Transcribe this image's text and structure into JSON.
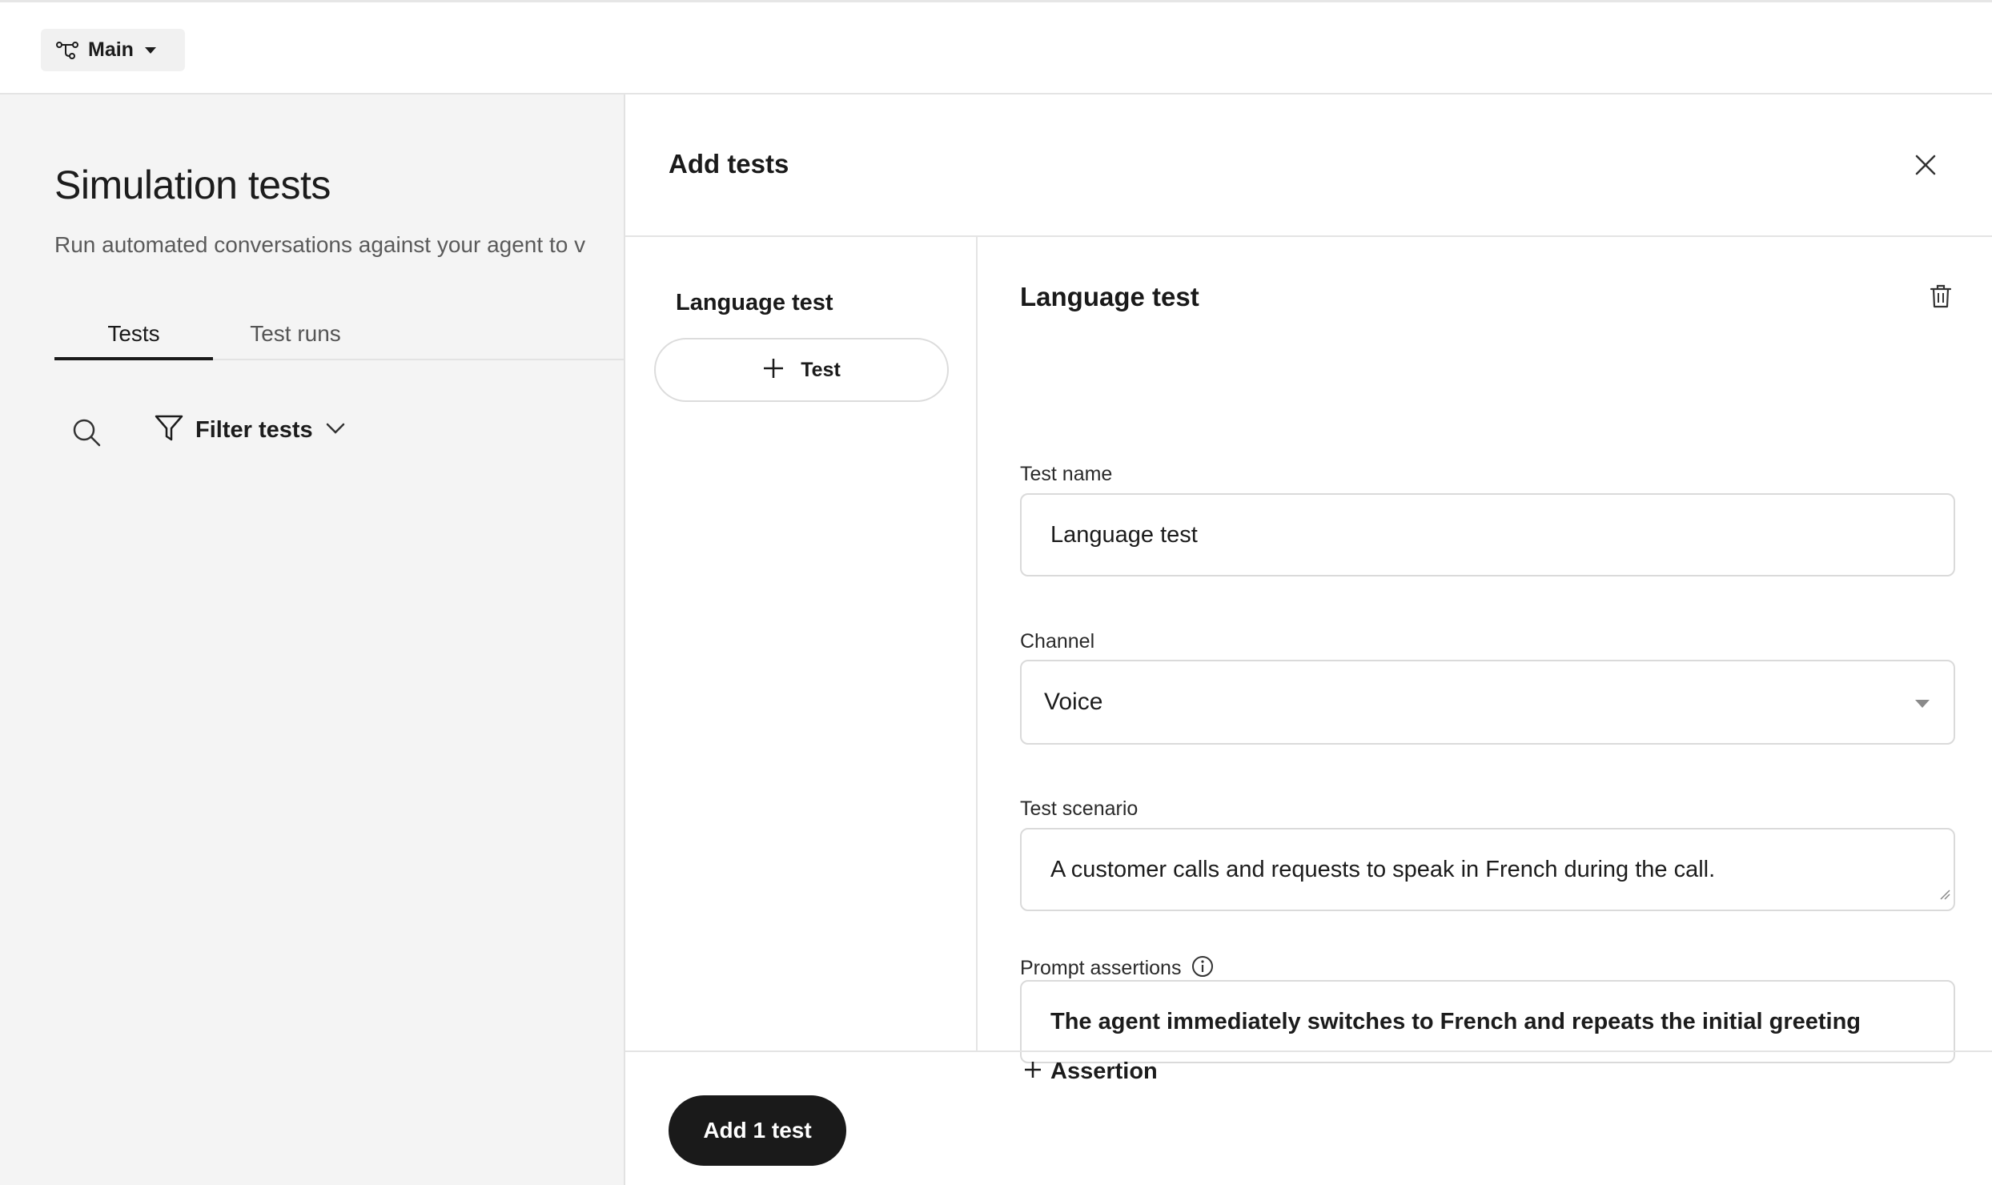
{
  "topbar": {
    "branch_label": "Main",
    "branch_icon": "branch-icon",
    "dropdown_icon": "caret-down-icon"
  },
  "background_page": {
    "title": "Simulation tests",
    "subtitle": "Run automated conversations against your agent to v",
    "tabs": [
      {
        "label": "Tests",
        "active": true
      },
      {
        "label": "Test runs",
        "active": false
      }
    ],
    "filter_label": "Filter tests"
  },
  "drawer": {
    "title": "Add tests",
    "tests_list": {
      "items": [
        {
          "label": "Language test"
        }
      ],
      "add_button_label": "Test"
    },
    "form": {
      "heading": "Language test",
      "test_name": {
        "label": "Test name",
        "value": "Language test"
      },
      "channel": {
        "label": "Channel",
        "value": "Voice"
      },
      "test_scenario": {
        "label": "Test scenario",
        "value": "A customer calls and requests to speak in French during the call."
      },
      "prompt_assertions": {
        "label": "Prompt assertions",
        "values": [
          "The agent immediately switches to French and repeats the initial greeting"
        ],
        "add_label": "Assertion"
      }
    },
    "footer": {
      "primary_label": "Add 1 test"
    }
  }
}
